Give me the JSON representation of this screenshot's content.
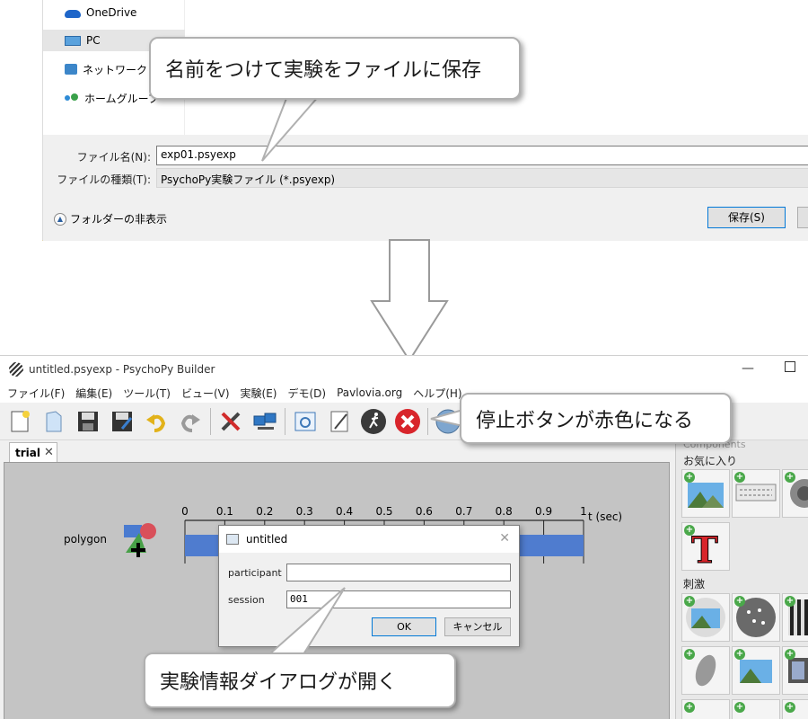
{
  "save_dialog": {
    "nav_items": [
      {
        "label": "OneDrive",
        "icon": "onedrive-icon"
      },
      {
        "label": "PC",
        "icon": "pc-icon"
      },
      {
        "label": "ネットワーク",
        "icon": "network-icon"
      },
      {
        "label": "ホームグループ",
        "icon": "homegroup-icon"
      }
    ],
    "filename_label": "ファイル名(N):",
    "filename_value": "exp01.psyexp",
    "filetype_label": "ファイルの種類(T):",
    "filetype_value": "PsychoPy実験ファイル (*.psyexp)",
    "hide_folders_label": "フォルダーの非表示",
    "save_label": "保存(S)"
  },
  "callouts": {
    "save_note": "名前をつけて実験をファイルに保存",
    "stop_note": "停止ボタンが赤色になる",
    "dialog_note": "実験情報ダイアログが開く"
  },
  "builder": {
    "window_title": "untitled.psyexp - PsychoPy Builder",
    "menu": [
      "ファイル(F)",
      "編集(E)",
      "ツール(T)",
      "ビュー(V)",
      "実験(E)",
      "デモ(D)",
      "Pavlovia.org",
      "ヘルプ(H)"
    ],
    "toolbar_icons": [
      "new-file-icon",
      "open-file-icon",
      "save-icon",
      "save-as-icon",
      "undo-icon",
      "redo-icon",
      "preferences-icon",
      "monitor-center-icon",
      "experiment-settings-icon",
      "compile-script-icon",
      "run-icon",
      "stop-icon"
    ],
    "tab_label": "trial",
    "routine": {
      "component_name": "polygon",
      "time_unit": "t (sec)"
    },
    "components_panel": {
      "title_partial": "Components",
      "favorites_label": "お気に入り",
      "stimuli_label": "刺激"
    }
  },
  "chart_data": {
    "type": "bar",
    "x_ticks": [
      "0",
      "0.1",
      "0.2",
      "0.3",
      "0.4",
      "0.5",
      "0.6",
      "0.7",
      "0.8",
      "0.9",
      "1"
    ],
    "xlim": [
      0,
      1
    ],
    "xlabel": "t (sec)",
    "series": [
      {
        "name": "polygon",
        "start": 0,
        "stop": 1
      }
    ]
  },
  "info_dialog": {
    "title": "untitled",
    "fields": [
      {
        "label": "participant",
        "value": ""
      },
      {
        "label": "session",
        "value": "001"
      }
    ],
    "ok_label": "OK",
    "cancel_label": "キャンセル"
  },
  "colors": {
    "timeline_bar": "#4f7ccf",
    "stop_red": "#d8252b",
    "accent_blue": "#0078d7"
  }
}
